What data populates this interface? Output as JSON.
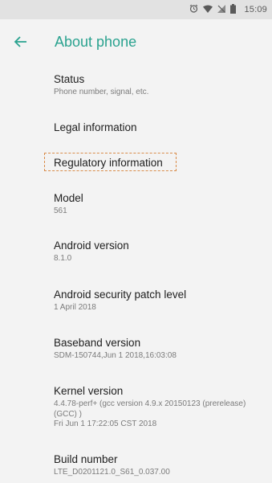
{
  "status_bar": {
    "icons": [
      "alarm-icon",
      "wifi-icon",
      "no-signal-icon",
      "battery-icon"
    ],
    "time": "15:09"
  },
  "app_bar": {
    "title": "About phone",
    "accent_color": "#2aa28f"
  },
  "items": [
    {
      "title": "Status",
      "summary": "Phone number, signal, etc."
    },
    {
      "title": "Legal information",
      "summary": ""
    },
    {
      "title": "Regulatory information",
      "summary": ""
    },
    {
      "title": "Model",
      "summary": "561"
    },
    {
      "title": "Android version",
      "summary": "8.1.0"
    },
    {
      "title": "Android security patch level",
      "summary": "1 April 2018"
    },
    {
      "title": "Baseband version",
      "summary": "SDM-150744,Jun  1 2018,16:03:08"
    },
    {
      "title": "Kernel version",
      "summary": "4.4.78-perf+ (gcc version 4.9.x 20150123 (prerelease) (GCC) )\nFri Jun 1 17:22:05 CST 2018"
    },
    {
      "title": "Build number",
      "summary": "LTE_D0201121.0_S61_0.037.00"
    }
  ]
}
